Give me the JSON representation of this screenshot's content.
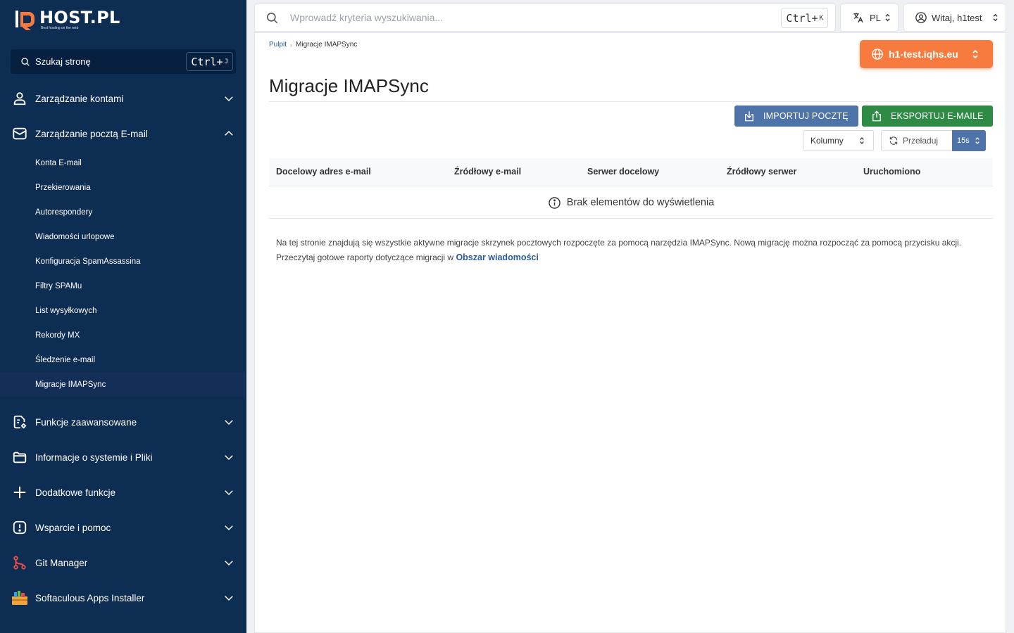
{
  "brand": {
    "name": "HOST.PL",
    "tagline": "Best hosting on the web"
  },
  "sidebar": {
    "search": {
      "label": "Szukaj stronę",
      "shortcut_key": "Ctrl+",
      "shortcut_letter": "J"
    },
    "sections": [
      {
        "label": "Zarządzanie kontami",
        "icon": "user-icon"
      },
      {
        "label": "Zarządzanie pocztą E-mail",
        "icon": "mail-icon"
      },
      {
        "label": "Funkcje zaawansowane",
        "icon": "doc-settings-icon"
      },
      {
        "label": "Informacje o systemie i Pliki",
        "icon": "folder-icon"
      },
      {
        "label": "Dodatkowe funkcje",
        "icon": "plus-icon"
      },
      {
        "label": "Wsparcie i pomoc",
        "icon": "alert-icon"
      },
      {
        "label": "Git Manager",
        "icon": "git-icon"
      },
      {
        "label": "Softaculous Apps Installer",
        "icon": "softaculous-icon"
      }
    ],
    "mail_items": [
      "Konta E-mail",
      "Przekierowania",
      "Autorespondery",
      "Wiadomości urlopowe",
      "Konfiguracja SpamAssassina",
      "Filtry SPAMu",
      "List wysyłkowych",
      "Rekordy MX",
      "Śledzenie e-mail",
      "Migracje IMAPSync"
    ],
    "active_item": "Migracje IMAPSync"
  },
  "topbar": {
    "search_placeholder": "Wprowadź kryteria wyszukiwania...",
    "shortcut_key": "Ctrl+",
    "shortcut_letter": "K",
    "language": "PL",
    "user_greeting": "Witaj, h1test"
  },
  "breadcrumb": {
    "home": "Pulpit",
    "current": "Migracje IMAPSync"
  },
  "domain": "h1-test.iqhs.eu",
  "page": {
    "title": "Migracje IMAPSync",
    "import_button": "IMPORTUJ POCZTĘ",
    "export_button": "EKSPORTUJ E-MAILE",
    "columns_button": "Kolumny",
    "reload_button": "Przeładuj",
    "reload_interval": "15s"
  },
  "table": {
    "columns": [
      "Docelowy adres e-mail",
      "Źródłowy e-mail",
      "Serwer docelowy",
      "Źródłowy serwer",
      "Uruchomiono"
    ],
    "empty_message": "Brak elementów do wyświetlenia"
  },
  "info": {
    "paragraph": "Na tej stronie znajdują się wszystkie aktywne migracje skrzynek pocztowych rozpoczęte za pomocą narzędzia IMAPSync. Nową migrację można rozpocząć za pomocą przycisku akcji.",
    "reports_prefix": "Przeczytaj gotowe raporty dotyczące migracji w",
    "reports_link": "Obszar wiadomości"
  },
  "colors": {
    "sidebar_bg": "#0e2d52",
    "accent_orange": "#f77b3e",
    "import_blue": "#4d73a8",
    "export_green": "#2e8b46"
  }
}
